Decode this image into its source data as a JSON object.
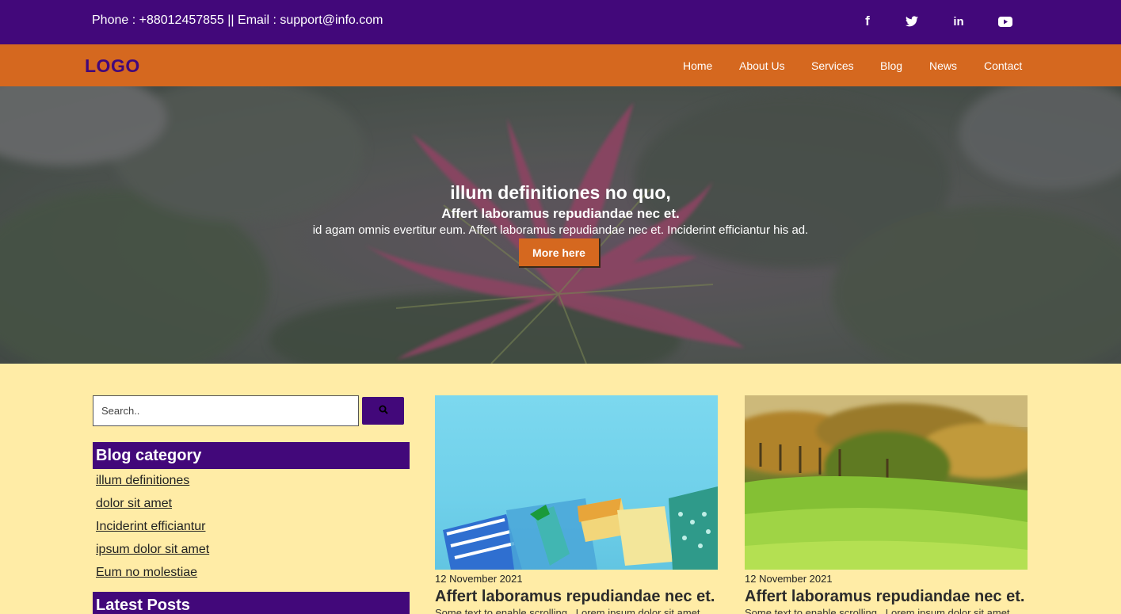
{
  "topbar": {
    "contact": "Phone : +88012457855 || Email : support@info.com",
    "social": [
      {
        "icon": "facebook-icon",
        "glyph": "f"
      },
      {
        "icon": "twitter-icon"
      },
      {
        "icon": "linkedin-icon",
        "glyph": "in"
      },
      {
        "icon": "youtube-icon"
      }
    ]
  },
  "nav": {
    "logo": "LOGO",
    "links": [
      "Home",
      "About Us",
      "Services",
      "Blog",
      "News",
      "Contact"
    ]
  },
  "hero": {
    "title": "illum definitiones no quo,",
    "subtitle": "Affert laboramus repudiandae nec et.",
    "description": "id agam omnis evertitur eum. Affert laboramus repudiandae nec et. Inciderint efficiantur his ad.",
    "cta": "More here"
  },
  "sidebar": {
    "search_placeholder": "Search..",
    "category_heading": "Blog category",
    "categories": [
      "illum definitiones",
      "dolor sit amet",
      "Inciderint efficiantur",
      "ipsum dolor sit amet",
      "Eum no molestiae"
    ],
    "latest_heading": "Latest Posts"
  },
  "posts": [
    {
      "date": "12 November 2021",
      "title": "Affert laboramus repudiandae nec et.",
      "excerpt": "Some text to enable scrolling.. Lorem ipsum dolor sit amet"
    },
    {
      "date": "12 November 2021",
      "title": "Affert laboramus repudiandae nec et.",
      "excerpt": "Some text to enable scrolling.. Lorem ipsum dolor sit amet"
    }
  ],
  "colors": {
    "topbar": "#42087a",
    "navbar": "#d5681f",
    "page_bg": "#ffeca6"
  }
}
